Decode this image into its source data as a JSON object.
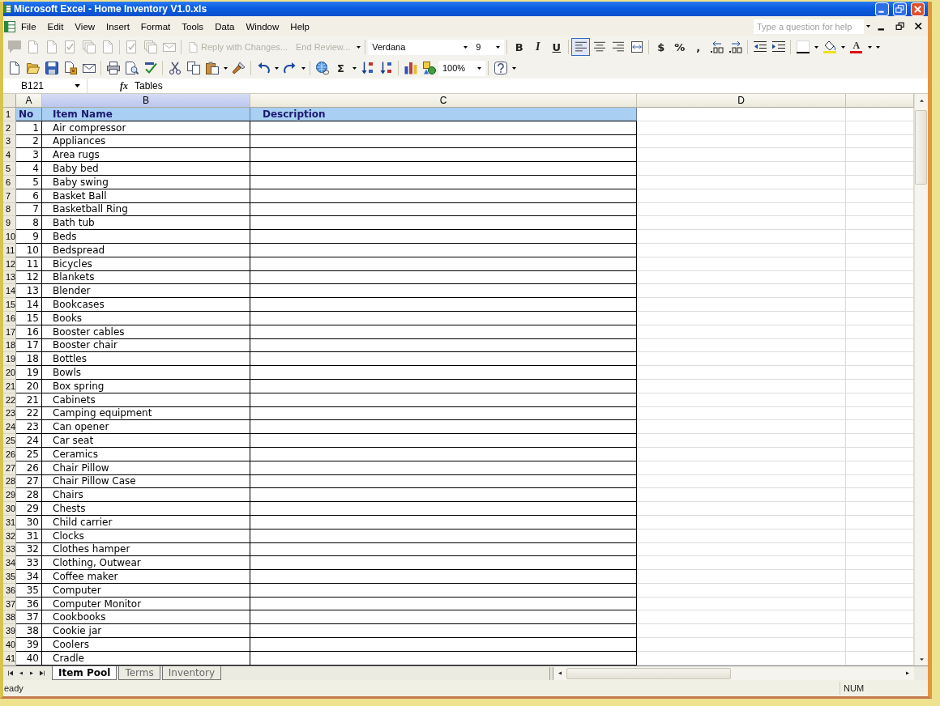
{
  "window": {
    "title": "Microsoft Excel - Home Inventory V1.0.xls"
  },
  "menu": [
    "File",
    "Edit",
    "View",
    "Insert",
    "Format",
    "Tools",
    "Data",
    "Window",
    "Help"
  ],
  "help_box": {
    "placeholder": "Type a question for help"
  },
  "reviewing_toolbar": {
    "disabled": true,
    "reply_button": "Reply with Changes...",
    "end_review_button": "End Review..."
  },
  "formatting_toolbar": {
    "font": "Verdana",
    "size": "9",
    "bold": "B",
    "italic": "I",
    "underline": "U",
    "alignment": [
      {
        "selected": true
      },
      {
        "selected": false
      },
      {
        "selected": false
      },
      {
        "selected": false
      }
    ],
    "currency": "$",
    "percent": "%",
    "comma": ",",
    "font_color": "A"
  },
  "standard_toolbar": {
    "autosum": "Σ",
    "zoom": "100%"
  },
  "formula_bar": {
    "name_box": "B121",
    "function_label": "fx",
    "content": "Tables"
  },
  "sheet": {
    "columns": [
      {
        "label": "A",
        "selected": false
      },
      {
        "label": "B",
        "selected": true
      },
      {
        "label": "C",
        "selected": false
      },
      {
        "label": "D",
        "selected": false
      }
    ],
    "header_row": {
      "row_number": "1",
      "no": "No",
      "item": "Item Name",
      "description": "Description"
    },
    "rows": [
      {
        "row_number": "2",
        "no": "1",
        "item": "Air compressor"
      },
      {
        "row_number": "3",
        "no": "2",
        "item": "Appliances"
      },
      {
        "row_number": "4",
        "no": "3",
        "item": "Area rugs"
      },
      {
        "row_number": "5",
        "no": "4",
        "item": "Baby bed"
      },
      {
        "row_number": "6",
        "no": "5",
        "item": "Baby swing"
      },
      {
        "row_number": "7",
        "no": "6",
        "item": "Basket Ball"
      },
      {
        "row_number": "8",
        "no": "7",
        "item": "Basketball Ring"
      },
      {
        "row_number": "9",
        "no": "8",
        "item": "Bath tub"
      },
      {
        "row_number": "10",
        "no": "9",
        "item": "Beds"
      },
      {
        "row_number": "11",
        "no": "10",
        "item": "Bedspread"
      },
      {
        "row_number": "12",
        "no": "11",
        "item": "Bicycles"
      },
      {
        "row_number": "13",
        "no": "12",
        "item": "Blankets"
      },
      {
        "row_number": "14",
        "no": "13",
        "item": "Blender"
      },
      {
        "row_number": "15",
        "no": "14",
        "item": "Bookcases"
      },
      {
        "row_number": "16",
        "no": "15",
        "item": "Books"
      },
      {
        "row_number": "17",
        "no": "16",
        "item": "Booster cables"
      },
      {
        "row_number": "18",
        "no": "17",
        "item": "Booster chair"
      },
      {
        "row_number": "19",
        "no": "18",
        "item": "Bottles"
      },
      {
        "row_number": "20",
        "no": "19",
        "item": "Bowls"
      },
      {
        "row_number": "21",
        "no": "20",
        "item": "Box spring"
      },
      {
        "row_number": "22",
        "no": "21",
        "item": "Cabinets"
      },
      {
        "row_number": "23",
        "no": "22",
        "item": "Camping equipment"
      },
      {
        "row_number": "24",
        "no": "23",
        "item": "Can opener"
      },
      {
        "row_number": "25",
        "no": "24",
        "item": "Car seat"
      },
      {
        "row_number": "26",
        "no": "25",
        "item": "Ceramics"
      },
      {
        "row_number": "27",
        "no": "26",
        "item": "Chair Pillow"
      },
      {
        "row_number": "28",
        "no": "27",
        "item": "Chair Pillow Case"
      },
      {
        "row_number": "29",
        "no": "28",
        "item": "Chairs"
      },
      {
        "row_number": "30",
        "no": "29",
        "item": "Chests"
      },
      {
        "row_number": "31",
        "no": "30",
        "item": "Child carrier"
      },
      {
        "row_number": "32",
        "no": "31",
        "item": "Clocks"
      },
      {
        "row_number": "33",
        "no": "32",
        "item": "Clothes hamper"
      },
      {
        "row_number": "34",
        "no": "33",
        "item": "Clothing, Outwear"
      },
      {
        "row_number": "35",
        "no": "34",
        "item": "Coffee maker"
      },
      {
        "row_number": "36",
        "no": "35",
        "item": "Computer"
      },
      {
        "row_number": "37",
        "no": "36",
        "item": "Computer Monitor"
      },
      {
        "row_number": "38",
        "no": "37",
        "item": "Cookbooks"
      },
      {
        "row_number": "39",
        "no": "38",
        "item": "Cookie jar"
      },
      {
        "row_number": "40",
        "no": "39",
        "item": "Coolers"
      },
      {
        "row_number": "41",
        "no": "40",
        "item": "Cradle"
      }
    ]
  },
  "sheet_tabs": [
    {
      "label": "Item Pool",
      "selected": true
    },
    {
      "label": "Terms",
      "selected": false
    },
    {
      "label": "Inventory",
      "selected": false
    }
  ],
  "status_bar": {
    "mode": "eady",
    "num_lock": "NUM"
  }
}
